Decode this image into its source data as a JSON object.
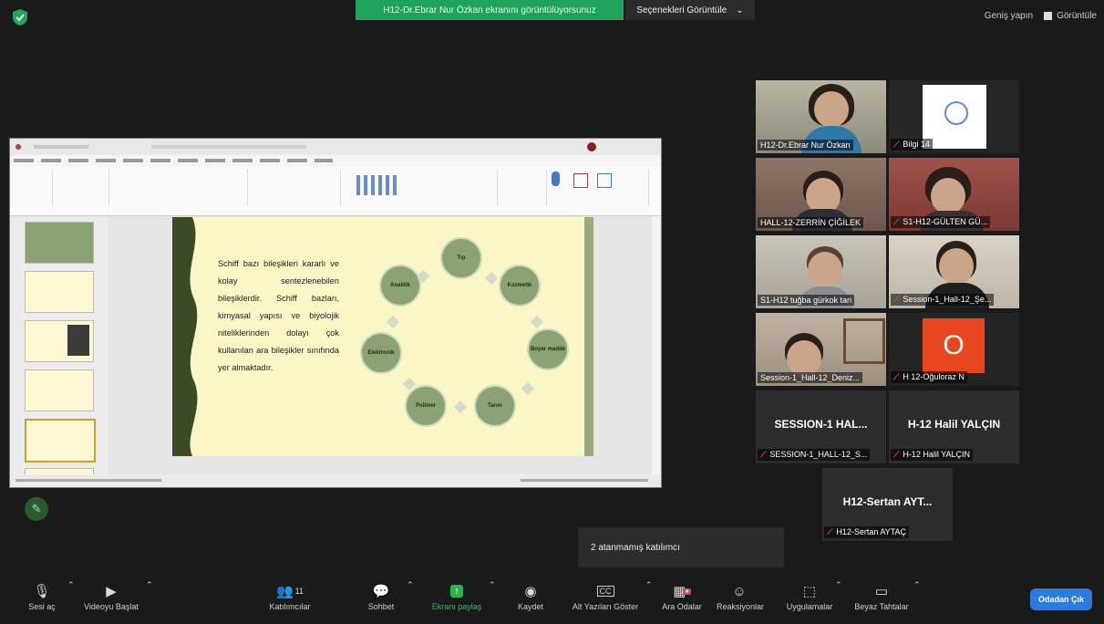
{
  "top": {
    "share_banner": "H12-Dr.Ebrar Nur Özkan ekranını görüntülüyorsunuz",
    "view_options": "Seçenekleri Görüntüle",
    "view_options_caret": "⌄",
    "exit_fullscreen": "Geniş yapın",
    "view": "Görüntüle"
  },
  "slide": {
    "text": "Schiff bazı bileşikleri kararlı ve kolay sentezlenebilen bileşiklerdir. Schiff bazları, kimyasal yapısı ve biyolojik niteliklerinden dolayı çok kullanılan ara bileşikler sınıfında yer almaktadır.",
    "nodes": [
      "Tıp",
      "Kozmetik",
      "Boyar madde",
      "Tarım",
      "Polimer",
      "Elektronik",
      "Analitik"
    ]
  },
  "participants": [
    {
      "name": "H12-Dr.Ebrar Nur Özkan",
      "muted": false
    },
    {
      "name": "Bilgi 14",
      "muted": true
    },
    {
      "name": "HALL-12-ZERRİN ÇİĞİLEK",
      "muted": false
    },
    {
      "name": "S1-H12-GÜLTEN GÜ...",
      "muted": true
    },
    {
      "name": "S1-H12 tuğba gürkok tan",
      "muted": false
    },
    {
      "name": "Session-1_Hall-12_Şe...",
      "muted": true
    },
    {
      "name": "Session-1_Hall-12_Deniz...",
      "muted": false
    },
    {
      "name": "H 12-Oğuloraz N",
      "muted": true,
      "initial": "O"
    },
    {
      "name": "SESSION-1_HALL-12_S...",
      "muted": true,
      "big": "SESSION-1  HAL..."
    },
    {
      "name": "H-12 Halil YALÇIN",
      "muted": true,
      "big": "H-12 Halil YALÇIN"
    },
    {
      "name": "H12-Sertan AYTAÇ",
      "muted": true,
      "big": "H12-Sertan AYT..."
    }
  ],
  "toast": "2 atanmamış katılımcı",
  "toolbar": {
    "mute": "Sesi aç",
    "video": "Videoyu Başlat",
    "participants": "Katılımcılar",
    "participants_count": "11",
    "chat": "Sohbet",
    "share": "Ekranı paylaş",
    "record": "Kaydet",
    "captions": "Alt Yazıları Göster",
    "breakout": "Ara Odalar",
    "reactions": "Reaksiyonlar",
    "apps": "Uygulamalar",
    "whiteboard": "Beyaz Tahtalar",
    "leave": "Odadan Çık"
  },
  "colors": {
    "share_green": "#1fa35a",
    "leave_blue": "#2d7bdc",
    "active_speaker": "#b6d23b",
    "muted_red": "#e0454f",
    "slide_bg": "#fbf6c5",
    "node_green": "#8aa274"
  },
  "icons": [
    "shield-icon",
    "mic-muted-icon",
    "video-off-icon",
    "participants-icon",
    "chat-icon",
    "share-screen-icon",
    "record-icon",
    "cc-icon",
    "breakout-icon",
    "reactions-icon",
    "apps-icon",
    "whiteboard-icon",
    "pencil-icon"
  ]
}
